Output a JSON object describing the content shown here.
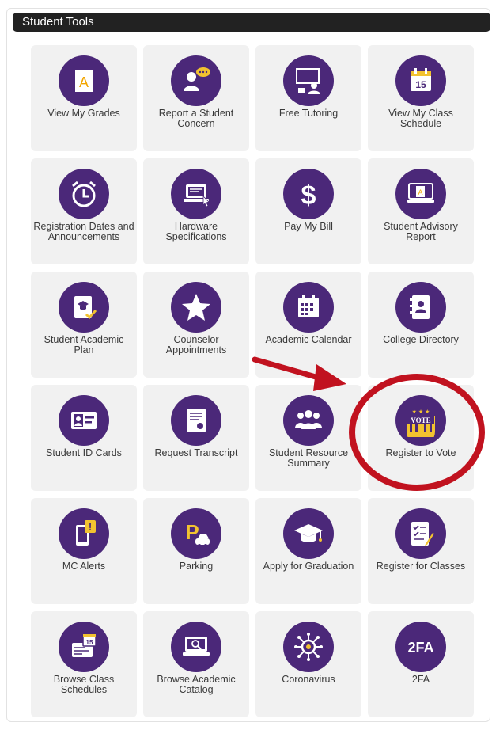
{
  "panel": {
    "title": "Student Tools"
  },
  "colors": {
    "icon_bg": "#4b2879",
    "tile_bg": "#f1f1f1",
    "accent_gold": "#f2c230",
    "annotation_red": "#c1121f"
  },
  "tiles": [
    {
      "label": "View My Grades",
      "icon": "grade-icon"
    },
    {
      "label": "Report a Student Concern",
      "icon": "concern-icon"
    },
    {
      "label": "Free Tutoring",
      "icon": "tutoring-icon"
    },
    {
      "label": "View My Class Schedule",
      "icon": "calendar-15-icon"
    },
    {
      "label": "Registration Dates and Announcements",
      "icon": "alarm-clock-icon"
    },
    {
      "label": "Hardware Specifications",
      "icon": "laptop-icon"
    },
    {
      "label": "Pay My Bill",
      "icon": "dollar-icon"
    },
    {
      "label": "Student Advisory Report",
      "icon": "report-icon"
    },
    {
      "label": "Student Academic Plan",
      "icon": "plan-icon"
    },
    {
      "label": "Counselor Appointments",
      "icon": "star-person-icon"
    },
    {
      "label": "Academic Calendar",
      "icon": "calendar-icon"
    },
    {
      "label": "College Directory",
      "icon": "directory-icon"
    },
    {
      "label": "Student ID Cards",
      "icon": "id-card-icon"
    },
    {
      "label": "Request Transcript",
      "icon": "transcript-icon"
    },
    {
      "label": "Student Resource Summary",
      "icon": "people-icon"
    },
    {
      "label": "Register to Vote",
      "icon": "vote-icon",
      "vote_text": "VOTE"
    },
    {
      "label": "MC Alerts",
      "icon": "alert-phone-icon"
    },
    {
      "label": "Parking",
      "icon": "parking-icon",
      "letter": "P"
    },
    {
      "label": "Apply for Graduation",
      "icon": "grad-cap-icon"
    },
    {
      "label": "Register for Classes",
      "icon": "checklist-icon"
    },
    {
      "label": "Browse Class Schedules",
      "icon": "schedule-icon",
      "badge": "15"
    },
    {
      "label": "Browse Academic Catalog",
      "icon": "catalog-icon"
    },
    {
      "label": "Coronavirus",
      "icon": "virus-icon"
    },
    {
      "label": "2FA",
      "icon": "twofa-icon",
      "text": "2FA"
    }
  ]
}
